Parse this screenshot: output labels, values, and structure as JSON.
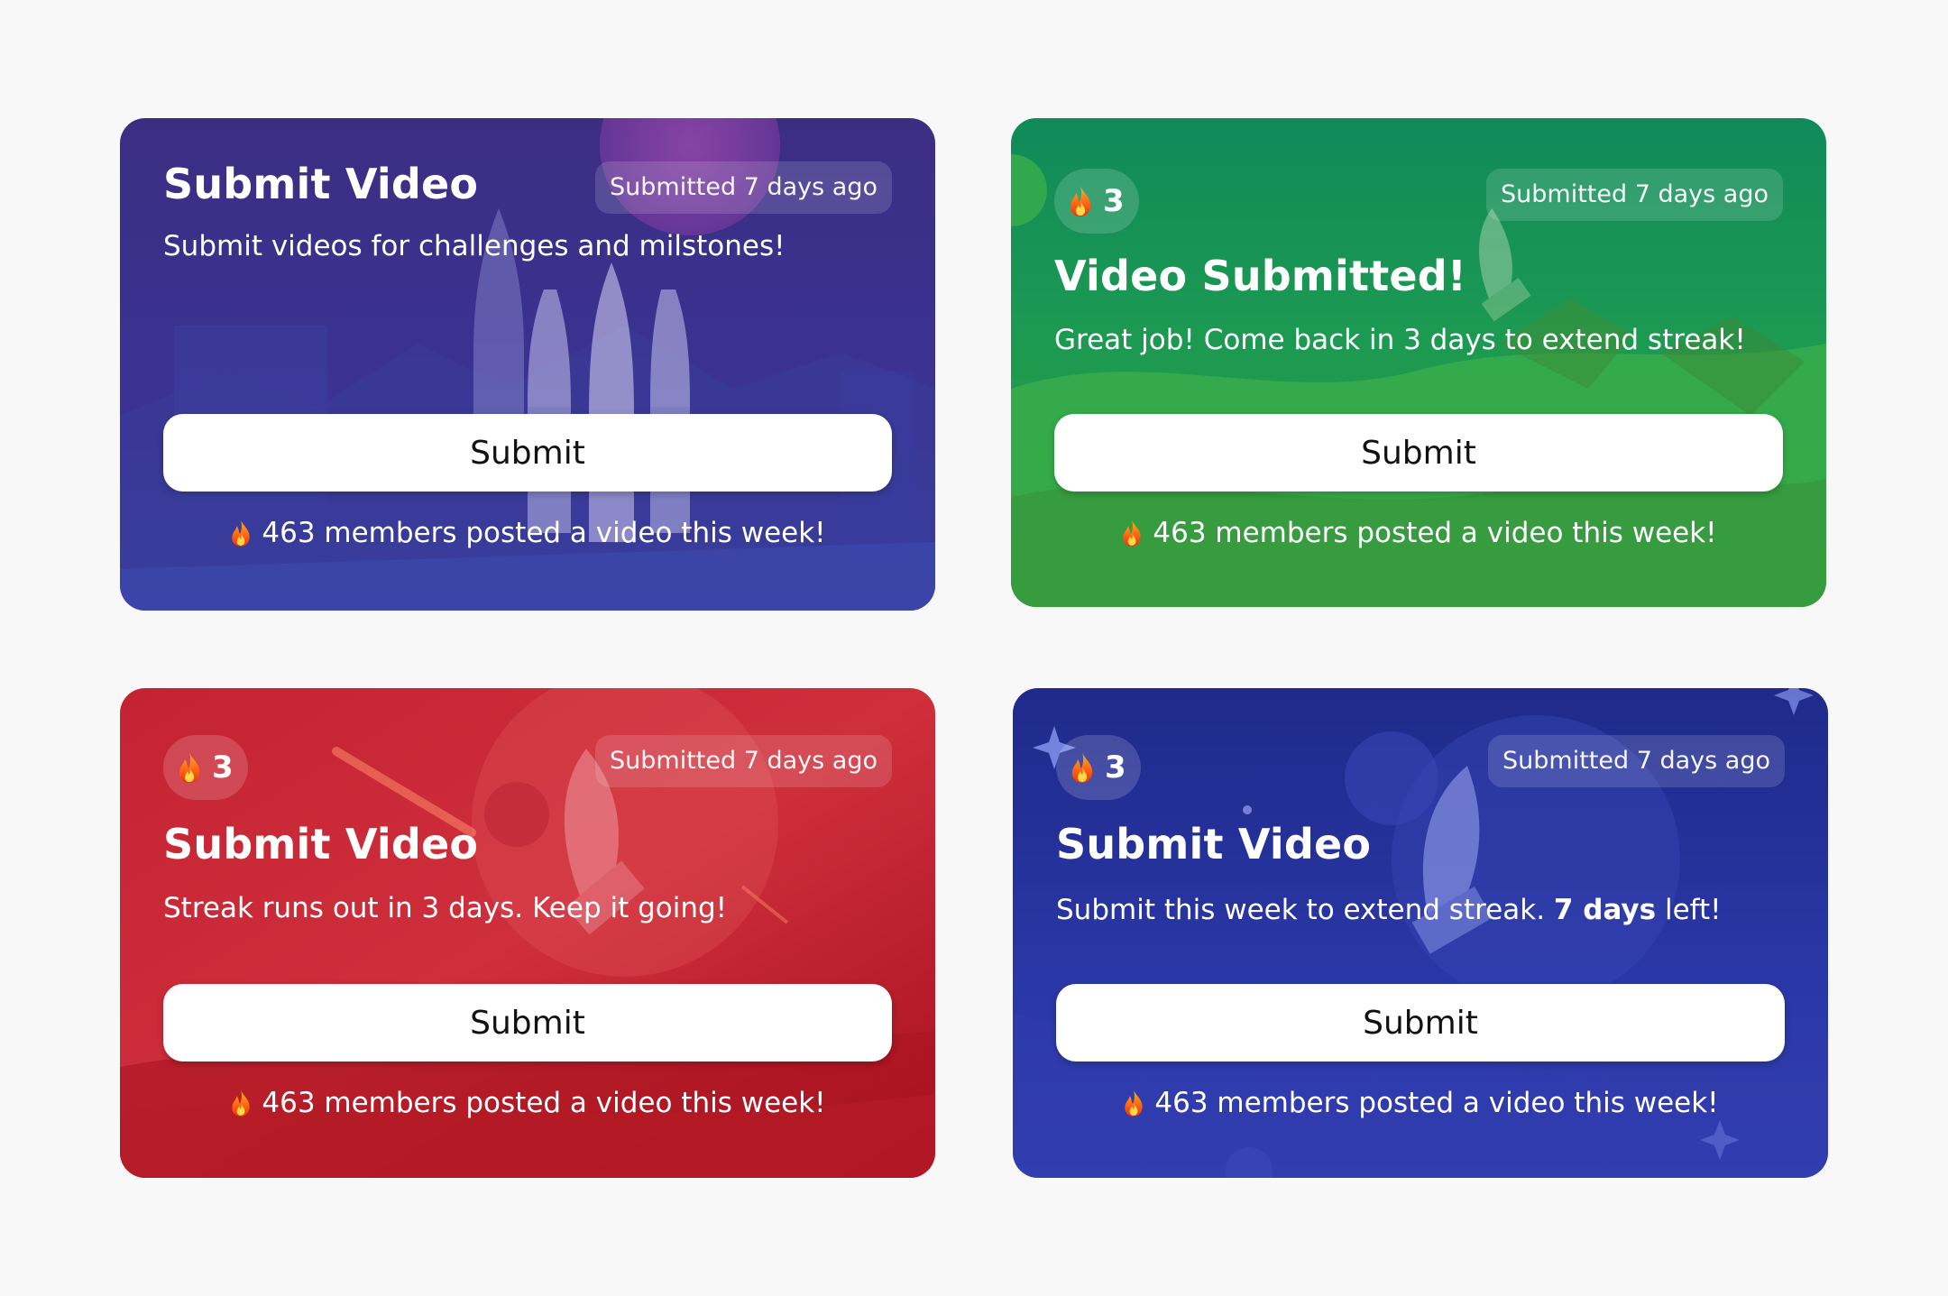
{
  "colors": {
    "page_background": "#f8f8f9",
    "card_purple": "#3c2f8a",
    "card_green": "#1f9a4e",
    "card_red": "#c8202c",
    "card_blue": "#24309a",
    "button": "#ffffff",
    "button_text": "#111111"
  },
  "icons": {
    "flame": "fire-icon"
  },
  "cards": [
    {
      "title": "Submit Video",
      "subtitle": "Submit videos for challenges and milstones!",
      "badge": "Submitted 7 days ago",
      "button": "Submit",
      "footer": "463 members posted a video this week!"
    },
    {
      "streak": "3",
      "badge": "Submitted 7 days ago",
      "title": "Video Submitted!",
      "subtitle": "Great job! Come back in 3 days to extend streak!",
      "button": "Submit",
      "footer": "463 members posted a video this week!"
    },
    {
      "streak": "3",
      "badge": "Submitted 7 days ago",
      "title": "Submit Video",
      "subtitle": "Streak runs out in 3 days. Keep it going!",
      "button": "Submit",
      "footer": "463 members posted a video this week!"
    },
    {
      "streak": "3",
      "badge": "Submitted 7 days ago",
      "title": "Submit Video",
      "subtitle_prefix": "Submit this week to extend streak.",
      "subtitle_bold": "7 days",
      "subtitle_suffix": "left!",
      "button": "Submit",
      "footer": "463 members posted a video this week!"
    }
  ]
}
